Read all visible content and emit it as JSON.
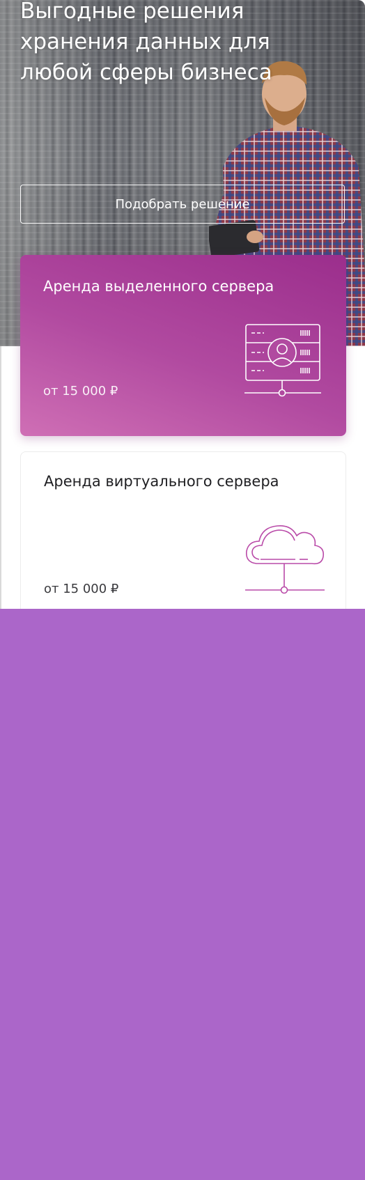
{
  "hero": {
    "title": "Выгодные решения хранения данных для любой сферы бизнеса",
    "cta_label": "Подобрать решение"
  },
  "cards": [
    {
      "title": "Аренда выделенного сервера",
      "price": "от 15 000 ₽",
      "icon": "dedicated-server-icon"
    },
    {
      "title": "Аренда виртуального сервера",
      "price": "от 15 000 ₽",
      "icon": "cloud-server-icon"
    }
  ],
  "colors": {
    "accent": "#ab66c9",
    "card_gradient_start": "#cf6fb5",
    "card_gradient_end": "#9b2e8c",
    "icon_stroke": "#b94aa8"
  }
}
